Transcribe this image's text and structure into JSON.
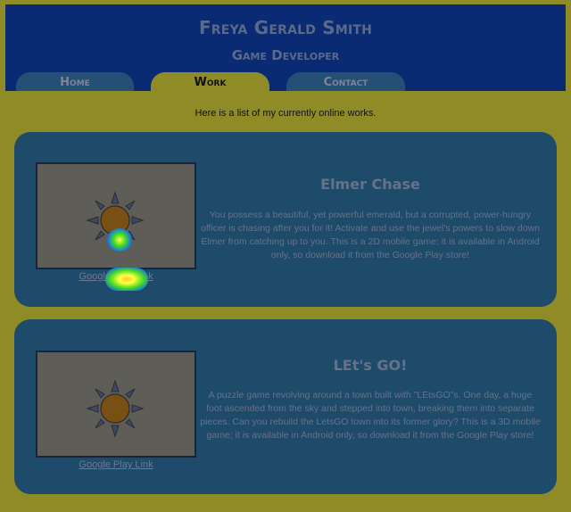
{
  "header": {
    "name": "Freya Gerald Smith",
    "role": "Game Developer"
  },
  "nav": {
    "tabs": [
      {
        "label": "Home",
        "active": false
      },
      {
        "label": "Work",
        "active": true
      },
      {
        "label": "Contact",
        "active": false
      }
    ]
  },
  "intro": "Here is a list of my currently online works.",
  "works": [
    {
      "title": "Elmer Chase",
      "description": "You possess a beautiful, yet powerful emerald, but a corrupted, power-hungry officer is chasing after you for it! Activate and use the jewel's powers to slow down Elmer from catching up to you. This is a 2D mobile game; it is available in Android only, so download it from the Google Play store!",
      "link": "Google Play Link"
    },
    {
      "title": "LEt's GO!",
      "description": "A puzzle game revolving around a town built with \"LEtsGO\"s. One day, a huge foot ascended from the sky and stepped into town, breaking them into separate pieces. Can you rebuild the LetsGO town into its former glory? This is a 3D mobile game; it is available in Android only, so download it from the Google Play store!",
      "link": "Google Play Link"
    }
  ],
  "icons": {
    "placeholder": "sun-icon"
  },
  "colors": {
    "page_bg": "#8f8b27",
    "header_bg": "#0a2a73",
    "card_bg": "#1e4b6a"
  }
}
